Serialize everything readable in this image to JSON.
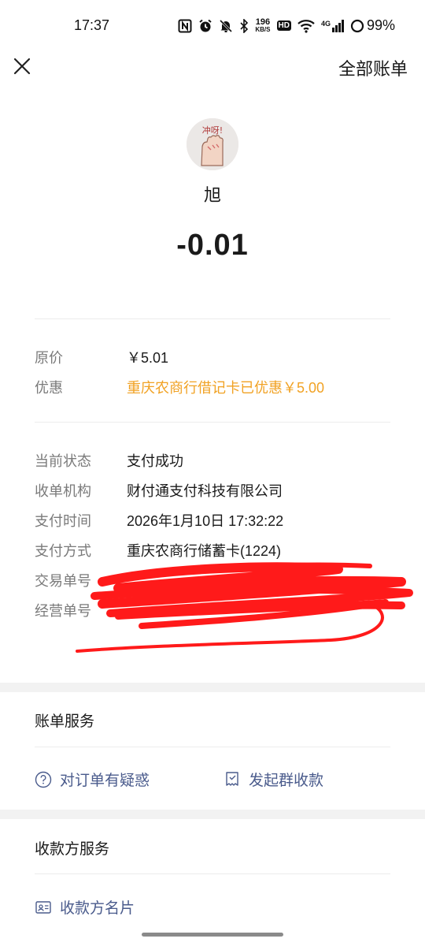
{
  "status_bar": {
    "time": "17:37",
    "net_speed_top": "196",
    "net_speed_bottom": "KB/S",
    "hd_label": "HD",
    "network_label": "4G",
    "battery": "99%"
  },
  "nav": {
    "close_icon": "close-icon",
    "all_bills_label": "全部账单"
  },
  "header": {
    "avatar_text": "冲呀!",
    "merchant_name": "旭",
    "amount": "-0.01"
  },
  "pricing": {
    "rows": [
      {
        "label": "原价",
        "value": "￥5.01"
      },
      {
        "label": "优惠",
        "value": "重庆农商行借记卡已优惠￥5.00"
      }
    ],
    "discount_color": "#f1a224"
  },
  "details": {
    "rows": [
      {
        "label": "当前状态",
        "value": "支付成功"
      },
      {
        "label": "收单机构",
        "value": "财付通支付科技有限公司"
      },
      {
        "label": "支付时间",
        "value": "2026年1月10日 17:32:22"
      },
      {
        "label": "支付方式",
        "value": "重庆农商行储蓄卡(1224)"
      },
      {
        "label": "交易单号",
        "value": ""
      },
      {
        "label": "经营单号",
        "value": ""
      }
    ]
  },
  "bill_services": {
    "title": "账单服务",
    "items": [
      {
        "icon": "question-circle-icon",
        "label": "对订单有疑惑"
      },
      {
        "icon": "group-receipt-icon",
        "label": "发起群收款"
      }
    ]
  },
  "payee_services": {
    "title": "收款方服务",
    "items": [
      {
        "icon": "business-card-icon",
        "label": "收款方名片"
      }
    ]
  },
  "colors": {
    "link": "#4a5b8c",
    "redaction": "#ff1a1a",
    "section_gap": "#f2f2f2"
  }
}
